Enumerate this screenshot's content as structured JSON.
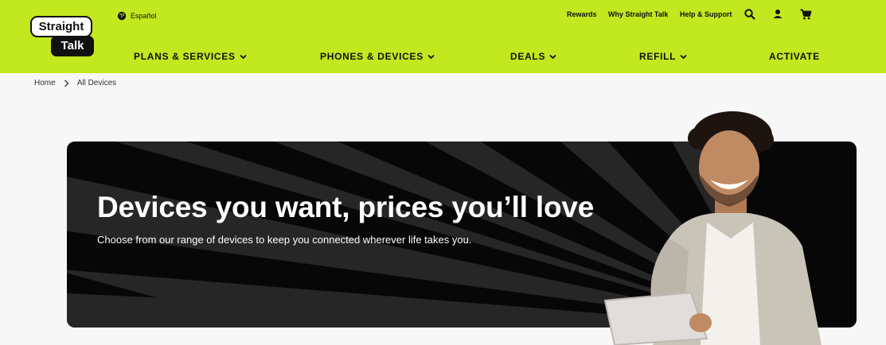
{
  "brand": {
    "logo_line1": "Straight",
    "logo_line2": "Talk",
    "accent": "#c2e81f"
  },
  "header": {
    "language_link": "Español",
    "utility_links": [
      "Rewards",
      "Why Straight Talk",
      "Help & Support"
    ],
    "icons": [
      "search-icon",
      "account-icon",
      "cart-icon"
    ]
  },
  "nav": {
    "items": [
      {
        "label": "PLANS & SERVICES",
        "has_dropdown": true
      },
      {
        "label": "PHONES & DEVICES",
        "has_dropdown": true
      },
      {
        "label": "DEALS",
        "has_dropdown": true
      },
      {
        "label": "REFILL",
        "has_dropdown": true
      },
      {
        "label": "ACTIVATE",
        "has_dropdown": false
      }
    ]
  },
  "breadcrumb": {
    "items": [
      "Home",
      "All Devices"
    ]
  },
  "hero": {
    "title": "Devices you want, prices you’ll love",
    "subtitle": "Choose from our range of devices to keep you connected wherever life takes you."
  }
}
